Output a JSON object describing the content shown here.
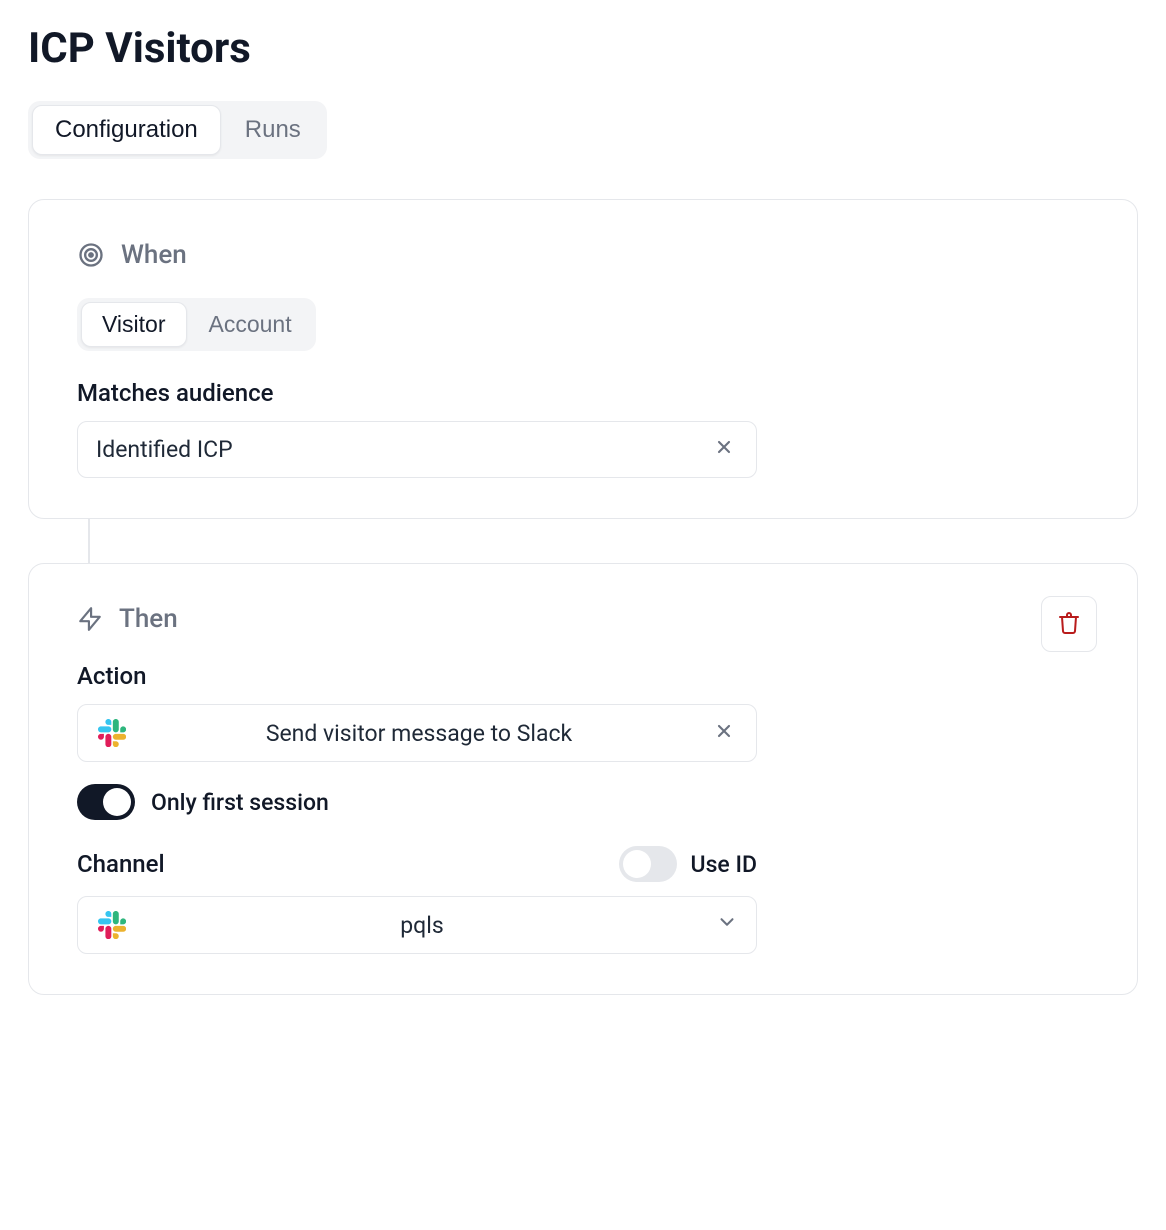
{
  "title": "ICP Visitors",
  "top_tabs": {
    "configuration": "Configuration",
    "runs": "Runs"
  },
  "when": {
    "heading": "When",
    "inner_tabs": {
      "visitor": "Visitor",
      "account": "Account"
    },
    "matches_label": "Matches audience",
    "audience_value": "Identified ICP"
  },
  "then": {
    "heading": "Then",
    "action_label": "Action",
    "action_value": "Send visitor message to Slack",
    "only_first_session_label": "Only first session",
    "only_first_session_on": true,
    "channel_label": "Channel",
    "use_id_label": "Use ID",
    "use_id_on": false,
    "channel_value": "pqls"
  }
}
